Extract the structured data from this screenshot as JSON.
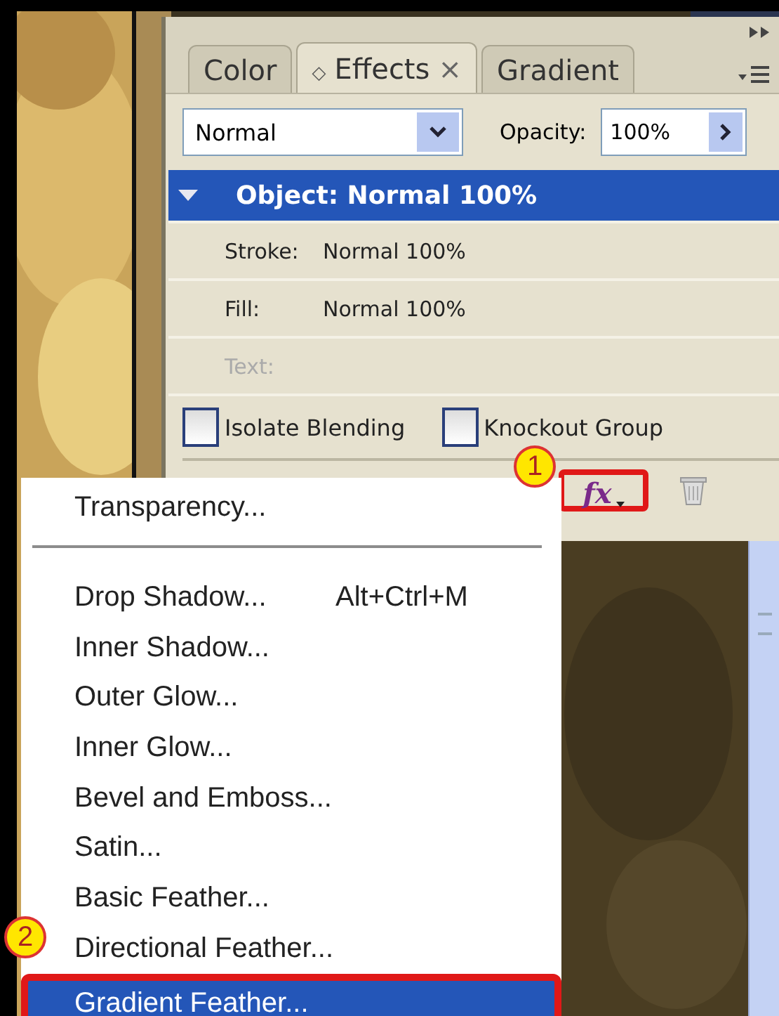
{
  "panel": {
    "tabs": [
      {
        "label": "Color",
        "selected": false
      },
      {
        "label": "Effects",
        "selected": true,
        "marker": "◇",
        "close": "×"
      },
      {
        "label": "Gradient",
        "selected": false
      }
    ],
    "blend_mode": {
      "value": "Normal"
    },
    "opacity": {
      "label": "Opacity:",
      "value": "100%"
    },
    "rows": [
      {
        "kind": "header",
        "label": "Object: Normal 100%",
        "selected": true,
        "expanded": true
      },
      {
        "kind": "attr",
        "label": "Stroke:",
        "value": "Normal 100%",
        "disabled": false
      },
      {
        "kind": "attr",
        "label": "Fill:",
        "value": "Normal 100%",
        "disabled": false
      },
      {
        "kind": "attr",
        "label": "Text:",
        "disabled": true
      }
    ],
    "checkboxes": [
      {
        "label": "Isolate Blending",
        "checked": false
      },
      {
        "label": "Knockout Group",
        "checked": false
      }
    ],
    "fx_button": {
      "label": "fx",
      "highlighted": true
    }
  },
  "menu": {
    "items": [
      {
        "kind": "item",
        "label": "Transparency...",
        "selected": false,
        "highlighted": false
      },
      {
        "kind": "separator"
      },
      {
        "kind": "item",
        "label": "Drop Shadow...",
        "shortcut": "Alt+Ctrl+M",
        "selected": false,
        "highlighted": false
      },
      {
        "kind": "item",
        "label": "Inner Shadow...",
        "selected": false,
        "highlighted": false
      },
      {
        "kind": "item",
        "label": "Outer Glow...",
        "selected": false,
        "highlighted": false
      },
      {
        "kind": "item",
        "label": "Inner Glow...",
        "selected": false,
        "highlighted": false
      },
      {
        "kind": "item",
        "label": "Bevel and Emboss...",
        "selected": false,
        "highlighted": false
      },
      {
        "kind": "item",
        "label": "Satin...",
        "selected": false,
        "highlighted": false
      },
      {
        "kind": "item",
        "label": "Basic Feather...",
        "selected": false,
        "highlighted": false
      },
      {
        "kind": "item",
        "label": "Directional Feather...",
        "selected": false,
        "highlighted": false
      },
      {
        "kind": "item",
        "label": "Gradient Feather...",
        "selected": true,
        "highlighted": true
      }
    ]
  },
  "callouts": [
    {
      "label": "1"
    },
    {
      "label": "2"
    }
  ]
}
